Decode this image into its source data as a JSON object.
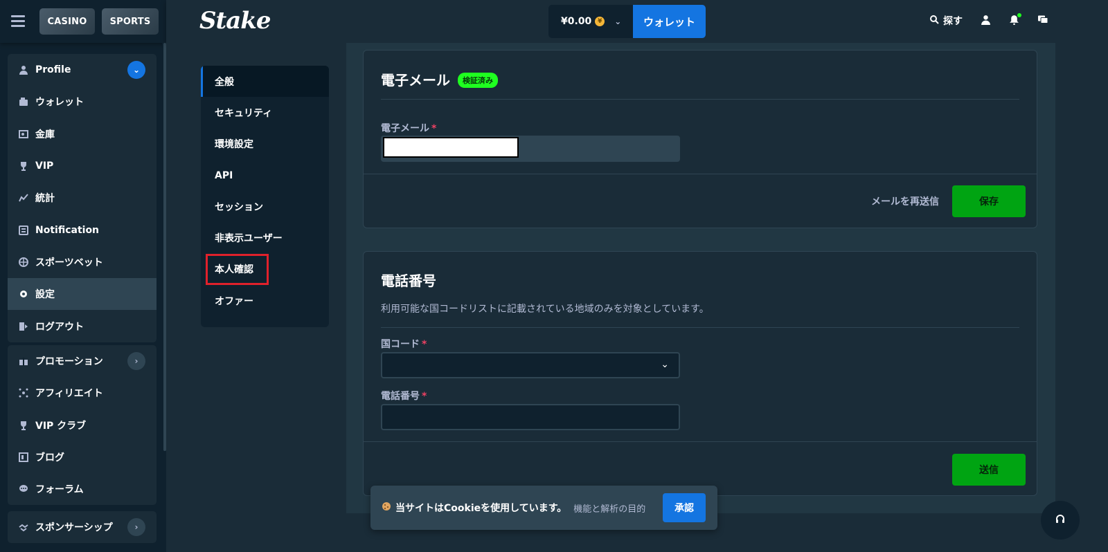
{
  "topleft": {
    "casino_label": "CASINO",
    "sports_label": "SPORTS"
  },
  "header": {
    "logo": "Stake",
    "balance": "¥0.00",
    "coin_symbol": "¥",
    "wallet_label": "ウォレット",
    "search_label": "探す"
  },
  "sidebar": {
    "group1": [
      {
        "label": "Profile",
        "icon": "user-icon"
      },
      {
        "label": "ウォレット",
        "icon": "wallet-icon"
      },
      {
        "label": "金庫",
        "icon": "vault-icon"
      },
      {
        "label": "VIP",
        "icon": "trophy-icon"
      },
      {
        "label": "統計",
        "icon": "stats-icon"
      },
      {
        "label": "Notification",
        "icon": "notification-icon"
      },
      {
        "label": "スポーツベット",
        "icon": "sportsbet-icon"
      },
      {
        "label": "設定",
        "icon": "gear-icon"
      },
      {
        "label": "ログアウト",
        "icon": "logout-icon"
      }
    ],
    "group2": [
      {
        "label": "プロモーション",
        "icon": "gift-icon"
      },
      {
        "label": "アフィリエイト",
        "icon": "affiliate-icon"
      },
      {
        "label": "VIP クラブ",
        "icon": "trophy-icon"
      },
      {
        "label": "ブログ",
        "icon": "blog-icon"
      },
      {
        "label": "フォーラム",
        "icon": "forum-icon"
      }
    ],
    "group3": [
      {
        "label": "スポンサーシップ",
        "icon": "handshake-icon"
      }
    ]
  },
  "settings_menu": {
    "items": [
      "全般",
      "セキュリティ",
      "環境設定",
      "API",
      "セッション",
      "非表示ユーザー",
      "本人確認",
      "オファー"
    ]
  },
  "email_card": {
    "title": "電子メール",
    "verified_badge": "検証済み",
    "field_label": "電子メール",
    "resend_label": "メールを再送信",
    "save_label": "保存"
  },
  "phone_card": {
    "title": "電話番号",
    "description": "利用可能な国コードリストに記載されている地域のみを対象としています。",
    "country_label": "国コード",
    "phone_label": "電話番号",
    "submit_label": "送信"
  },
  "cookie": {
    "text": "当サイトはCookieを使用しています。",
    "sub": "機能と解析の目的",
    "accept": "承認"
  }
}
